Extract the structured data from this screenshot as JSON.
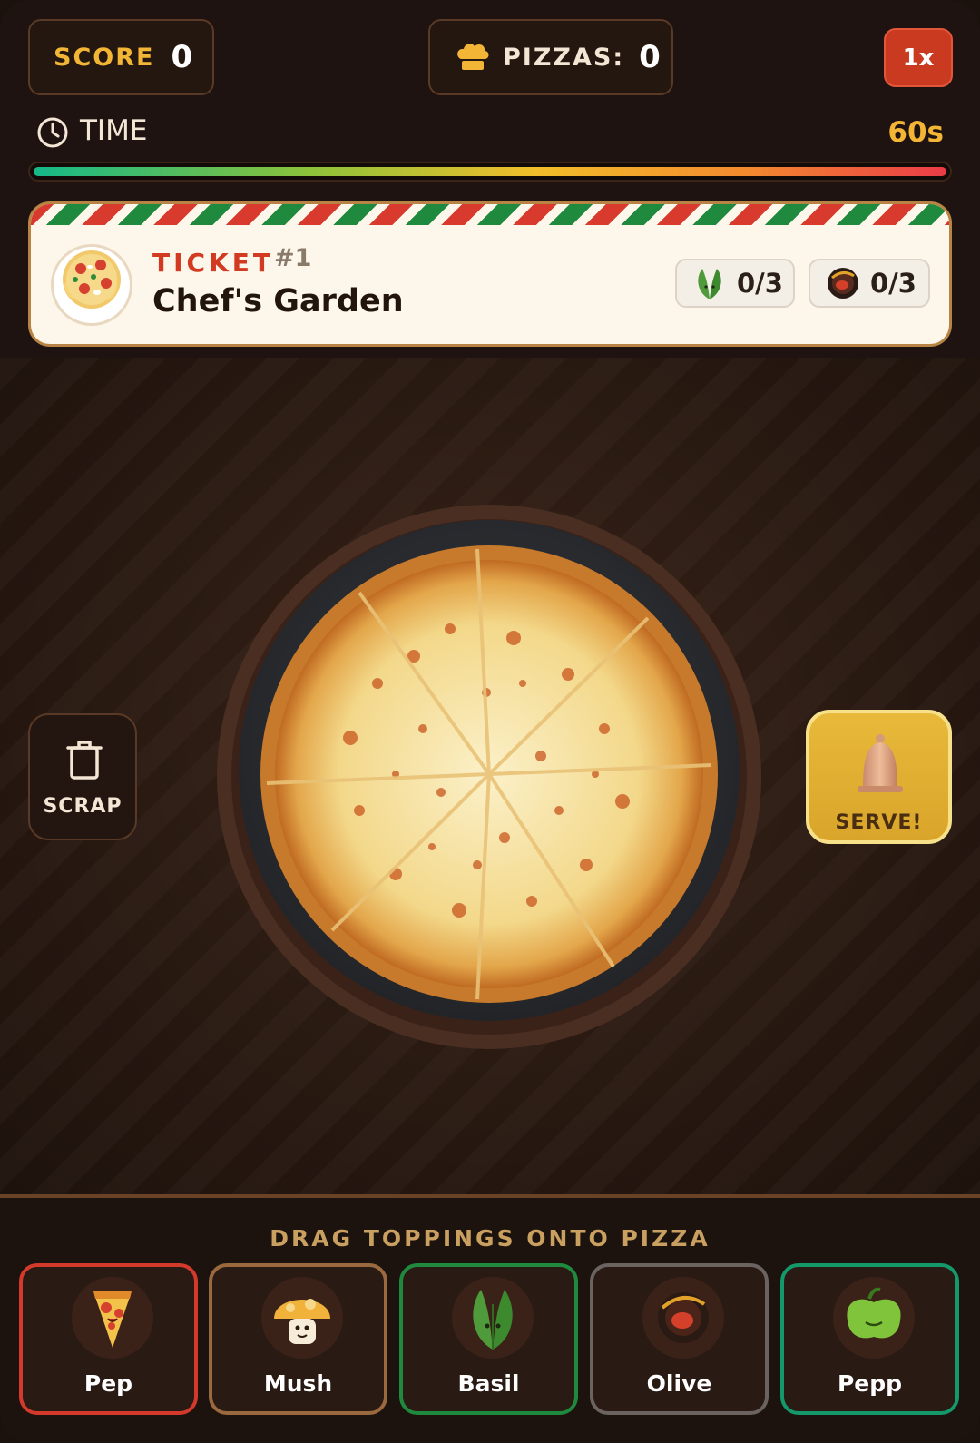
{
  "hud": {
    "score_label": "SCORE",
    "score_value": "0",
    "pizzas_label": "PIZZAS:",
    "pizzas_value": "0",
    "multiplier": "1x",
    "time_label": "TIME",
    "time_value": "60s",
    "time_remaining_fraction": 1.0
  },
  "ticket": {
    "label": "TICKET",
    "number": "#1",
    "title": "Chef's Garden",
    "requirements": [
      {
        "icon": "basil-icon",
        "count": "0/3"
      },
      {
        "icon": "olive-icon",
        "count": "0/3"
      }
    ]
  },
  "actions": {
    "scrap_label": "SCRAP",
    "serve_label": "SERVE!"
  },
  "tray": {
    "title": "DRAG TOPPINGS ONTO PIZZA",
    "toppings": [
      {
        "label": "Pep",
        "icon": "pepperoni-icon",
        "border": "#d43a2c"
      },
      {
        "label": "Mush",
        "icon": "mushroom-icon",
        "border": "#9a6a3e"
      },
      {
        "label": "Basil",
        "icon": "basil-icon",
        "border": "#1f8a3e"
      },
      {
        "label": "Olive",
        "icon": "olive-icon",
        "border": "#6b6360"
      },
      {
        "label": "Pepp",
        "icon": "pepper-icon",
        "border": "#14996a"
      }
    ]
  },
  "colors": {
    "accent_gold": "#f2b535",
    "ticket_red": "#d23a22",
    "serve_gold": "#e8b93a",
    "mult_red": "#c93a20"
  }
}
